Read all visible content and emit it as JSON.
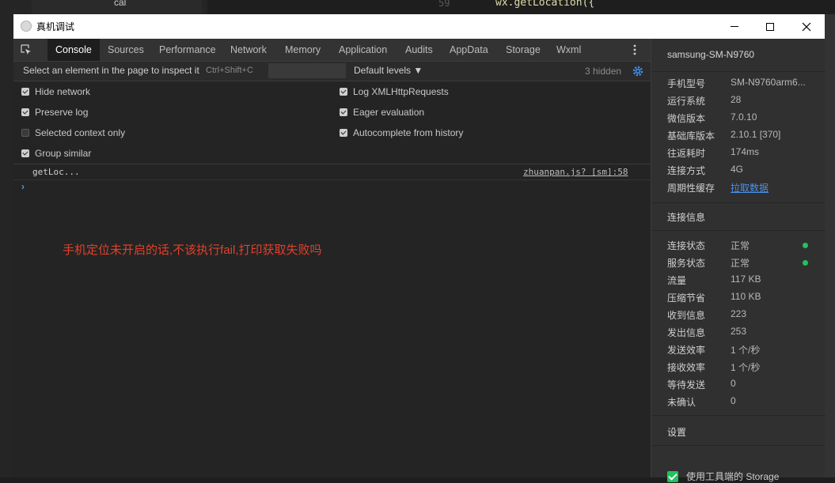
{
  "background": {
    "line_number": "59",
    "code_text": "wx.getLocation({",
    "folder_label": "cal"
  },
  "window": {
    "title": "真机调试"
  },
  "tabs": [
    {
      "label": "Console",
      "active": true
    },
    {
      "label": "Sources",
      "active": false
    },
    {
      "label": "Performance",
      "active": false
    },
    {
      "label": "Network",
      "active": false
    },
    {
      "label": "Memory",
      "active": false
    },
    {
      "label": "Application",
      "active": false
    },
    {
      "label": "Audits",
      "active": false
    },
    {
      "label": "AppData",
      "active": false
    },
    {
      "label": "Storage",
      "active": false
    },
    {
      "label": "Wxml",
      "active": false
    }
  ],
  "filter": {
    "inspect_hint": "Select an element in the page to inspect it",
    "shortcut": "Ctrl+Shift+C",
    "levels": "Default levels ▼",
    "hidden_count": "3 hidden"
  },
  "options": {
    "hide_network": {
      "label": "Hide network",
      "checked": true
    },
    "preserve_log": {
      "label": "Preserve log",
      "checked": true
    },
    "selected_context": {
      "label": "Selected context only",
      "checked": false
    },
    "group_similar": {
      "label": "Group similar",
      "checked": true
    },
    "log_xhr": {
      "label": "Log XMLHttpRequests",
      "checked": true
    },
    "eager_eval": {
      "label": "Eager evaluation",
      "checked": true
    },
    "autocomplete": {
      "label": "Autocomplete from history",
      "checked": true
    }
  },
  "console": {
    "message": "getLoc...",
    "source": "zhuanpan.js? [sm]:58",
    "prompt": "›",
    "annotation": "手机定位未开启的话,不该执行fail,打印获取失败吗"
  },
  "device": {
    "name": "samsung-SM-N9760",
    "info": [
      {
        "label": "手机型号",
        "value": "SM-N9760arm6..."
      },
      {
        "label": "运行系统",
        "value": "28"
      },
      {
        "label": "微信版本",
        "value": "7.0.10"
      },
      {
        "label": "基础库版本",
        "value": "2.10.1 [370]"
      },
      {
        "label": "往返耗时",
        "value": "174ms"
      },
      {
        "label": "连接方式",
        "value": "4G"
      },
      {
        "label": "周期性缓存",
        "value": "拉取数据"
      }
    ],
    "connection_title": "连接信息",
    "connection": [
      {
        "label": "连接状态",
        "value": "正常"
      },
      {
        "label": "服务状态",
        "value": "正常"
      },
      {
        "label": "流量",
        "value": "117 KB"
      },
      {
        "label": "压缩节省",
        "value": "110 KB"
      },
      {
        "label": "收到信息",
        "value": "223"
      },
      {
        "label": "发出信息",
        "value": "253"
      },
      {
        "label": "发送效率",
        "value": "1 个/秒"
      },
      {
        "label": "接收效率",
        "value": "1 个/秒"
      },
      {
        "label": "等待发送",
        "value": "0"
      },
      {
        "label": "未确认",
        "value": "0"
      }
    ],
    "settings_title": "设置",
    "storage_option": "使用工具端的 Storage"
  },
  "colors": {
    "accent_green": "#21c25c",
    "link_blue": "#4a8fe7",
    "annotation_red": "#e2402a"
  }
}
